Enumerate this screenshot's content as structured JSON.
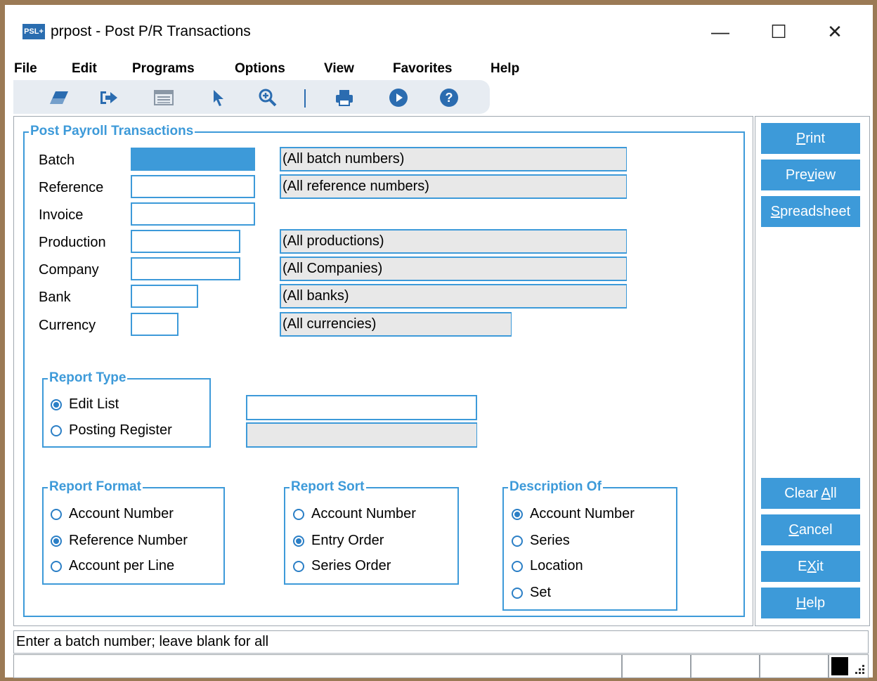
{
  "window": {
    "app_icon_text": "PSL+",
    "title": "prpost - Post P/R Transactions",
    "minimize_glyph": "—",
    "maximize_glyph": "☐",
    "close_glyph": "✕"
  },
  "menu": [
    "File",
    "Edit",
    "Programs",
    "Options",
    "View",
    "Favorites",
    "Help"
  ],
  "toolbar": {
    "icons": [
      "eraser-icon",
      "exit-icon",
      "list-icon",
      "pointer-icon",
      "zoom-in-icon",
      "print-icon",
      "play-icon",
      "help-icon"
    ],
    "color": "#2b6cb0"
  },
  "main": {
    "group_title": "Post Payroll Transactions",
    "fields": {
      "batch": {
        "label": "Batch",
        "value": "",
        "desc": "(All batch numbers)"
      },
      "reference": {
        "label": "Reference",
        "value": "",
        "desc": "(All reference numbers)"
      },
      "invoice": {
        "label": "Invoice",
        "value": ""
      },
      "production": {
        "label": "Production",
        "value": "",
        "desc": "(All productions)"
      },
      "company": {
        "label": "Company",
        "value": "",
        "desc": "(All Companies)"
      },
      "bank": {
        "label": "Bank",
        "value": "",
        "desc": "(All banks)"
      },
      "currency": {
        "label": "Currency",
        "value": "",
        "desc": "(All currencies)"
      }
    },
    "report_type": {
      "title": "Report Type",
      "options": [
        "Edit List",
        "Posting Register"
      ],
      "selected": "Edit List",
      "field_value": "",
      "field_desc": ""
    },
    "report_format": {
      "title": "Report Format",
      "options": [
        "Account Number",
        "Reference Number",
        "Account per Line"
      ],
      "selected": "Reference Number"
    },
    "report_sort": {
      "title": "Report Sort",
      "options": [
        "Account Number",
        "Entry Order",
        "Series Order"
      ],
      "selected": "Entry Order"
    },
    "description_of": {
      "title": "Description Of",
      "options": [
        "Account Number",
        "Series",
        "Location",
        "Set"
      ],
      "selected": "Account Number"
    }
  },
  "side_buttons": {
    "print": {
      "pre": "",
      "u": "P",
      "post": "rint"
    },
    "preview": {
      "pre": "Pre",
      "u": "v",
      "post": "iew"
    },
    "spreadsheet": {
      "pre": "",
      "u": "S",
      "post": "preadsheet"
    },
    "clear_all": {
      "pre": "Clear ",
      "u": "A",
      "post": "ll"
    },
    "cancel": {
      "pre": "",
      "u": "C",
      "post": "ancel"
    },
    "exit": {
      "pre": "E",
      "u": "X",
      "post": "it"
    },
    "help": {
      "pre": "",
      "u": "H",
      "post": "elp"
    }
  },
  "status": {
    "message": "Enter a batch number; leave blank for all"
  },
  "colors": {
    "accent": "#3d9ad9",
    "frame": "#9b7a55"
  }
}
